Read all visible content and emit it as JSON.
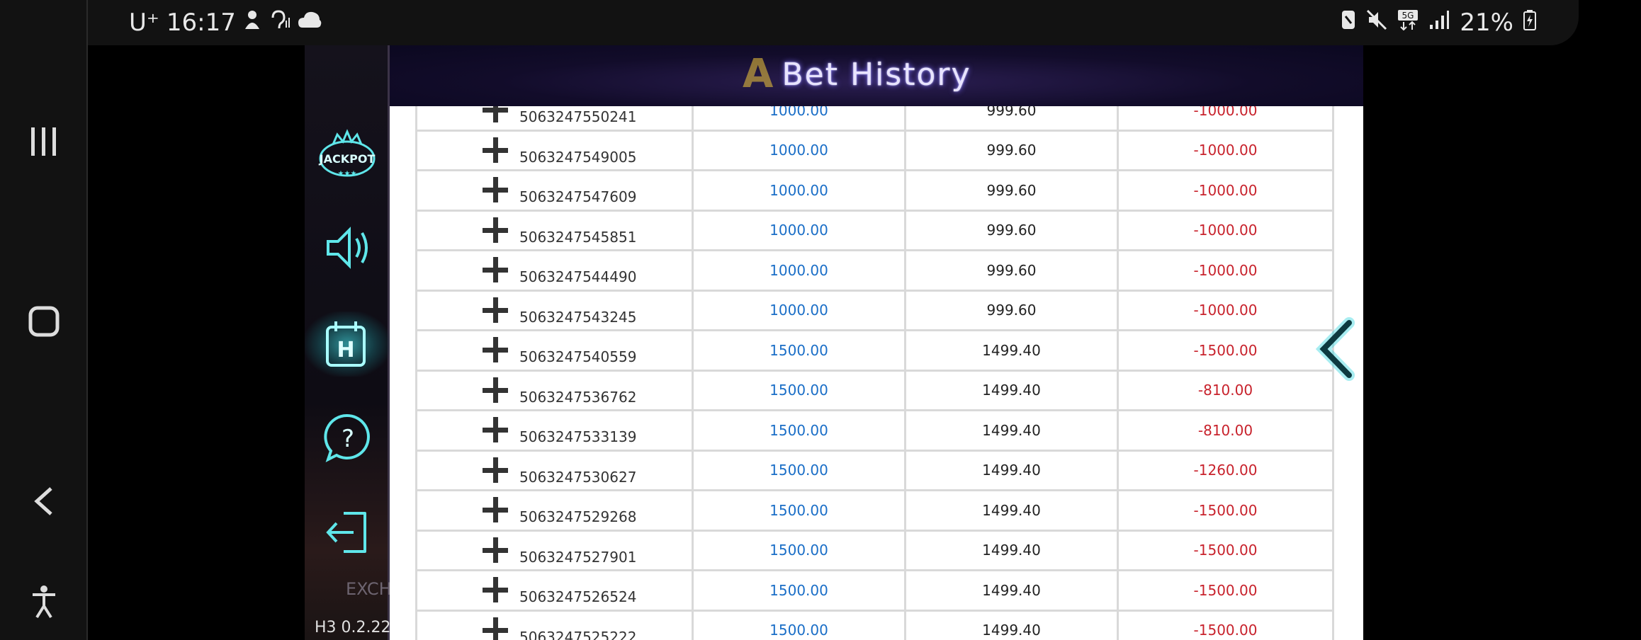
{
  "statusbar": {
    "carrier": "U⁺",
    "time": "16:17",
    "battery": "21%"
  },
  "game": {
    "title": "Bet History",
    "version": "H3 0.2.22",
    "exchange_label": "EXCH"
  },
  "sidebar_icons": [
    "jackpot-icon",
    "sound-icon",
    "history-icon",
    "help-icon",
    "exit-icon"
  ],
  "jackpot_text": "JACKPOT",
  "history_letter": "H",
  "help_glyph": "?",
  "rows": [
    {
      "id": "5063247550241",
      "bet": "1000.00",
      "valid": "999.60",
      "win": "-1000.00"
    },
    {
      "id": "5063247549005",
      "bet": "1000.00",
      "valid": "999.60",
      "win": "-1000.00"
    },
    {
      "id": "5063247547609",
      "bet": "1000.00",
      "valid": "999.60",
      "win": "-1000.00"
    },
    {
      "id": "5063247545851",
      "bet": "1000.00",
      "valid": "999.60",
      "win": "-1000.00"
    },
    {
      "id": "5063247544490",
      "bet": "1000.00",
      "valid": "999.60",
      "win": "-1000.00"
    },
    {
      "id": "5063247543245",
      "bet": "1000.00",
      "valid": "999.60",
      "win": "-1000.00"
    },
    {
      "id": "5063247540559",
      "bet": "1500.00",
      "valid": "1499.40",
      "win": "-1500.00"
    },
    {
      "id": "5063247536762",
      "bet": "1500.00",
      "valid": "1499.40",
      "win": "-810.00"
    },
    {
      "id": "5063247533139",
      "bet": "1500.00",
      "valid": "1499.40",
      "win": "-810.00"
    },
    {
      "id": "5063247530627",
      "bet": "1500.00",
      "valid": "1499.40",
      "win": "-1260.00"
    },
    {
      "id": "5063247529268",
      "bet": "1500.00",
      "valid": "1499.40",
      "win": "-1500.00"
    },
    {
      "id": "5063247527901",
      "bet": "1500.00",
      "valid": "1499.40",
      "win": "-1500.00"
    },
    {
      "id": "5063247526524",
      "bet": "1500.00",
      "valid": "1499.40",
      "win": "-1500.00"
    },
    {
      "id": "5063247525222",
      "bet": "1500.00",
      "valid": "1499.40",
      "win": "-1500.00"
    }
  ],
  "colors": {
    "bet": "#1a6ec7",
    "loss": "#c8222c",
    "neon": "#3fd8e0"
  }
}
